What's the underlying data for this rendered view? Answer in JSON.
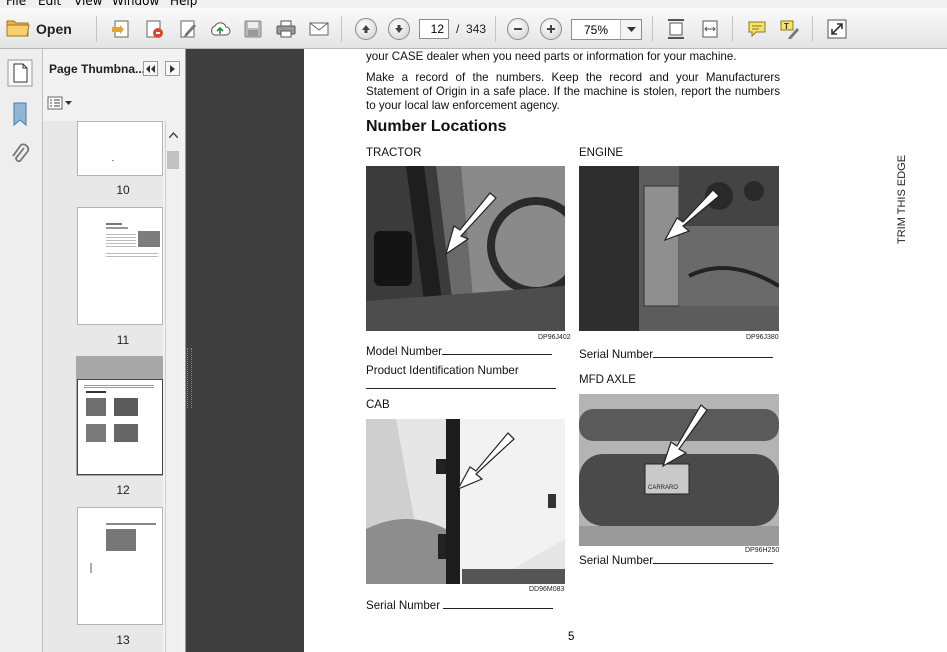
{
  "menu": [
    "File",
    "Edit",
    "View",
    "Window",
    "Help"
  ],
  "toolbar": {
    "open_label": "Open",
    "page_current": "12",
    "page_separator": "/",
    "page_total": "343",
    "zoom": "75%"
  },
  "nav_panel": {
    "title": "Page Thumbna...",
    "thumbnails": [
      {
        "page": "10"
      },
      {
        "page": "11"
      },
      {
        "page": "12"
      },
      {
        "page": "13"
      }
    ]
  },
  "document": {
    "intro_line": "your CASE dealer when you need parts or information for your machine.",
    "intro_paragraph": "Make a record of the numbers. Keep the record and your Manufacturers Statement of Origin in a safe place. If the machine is stolen, report the numbers to your local law enforcement agency.",
    "section_title": "Number Locations",
    "tractor": {
      "label": "TRACTOR",
      "code": "DP96J402",
      "field1": "Model Number",
      "field2": "Product Identification Number"
    },
    "engine": {
      "label": "ENGINE",
      "code": "DP96J380",
      "field": "Serial Number"
    },
    "cab": {
      "label": "CAB",
      "code": "DD96M083",
      "field": "Serial Number"
    },
    "axle": {
      "label": "MFD AXLE",
      "code": "DP96H250",
      "field": "Serial Number",
      "plate_text": "CARRARO"
    },
    "trim_label": "TRIM THIS EDGE",
    "page_number": "5"
  }
}
